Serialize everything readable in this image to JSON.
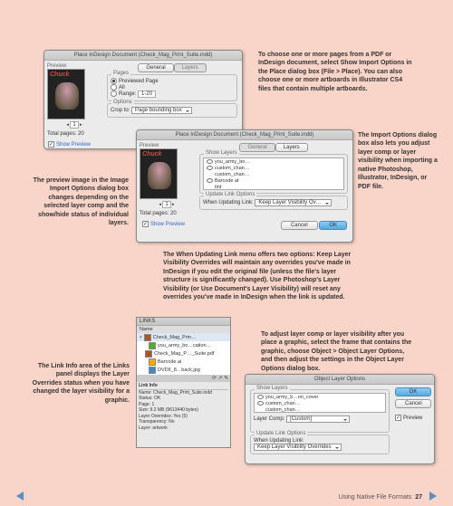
{
  "dialog1": {
    "title": "Place InDesign Document (Check_Mag_Print_Suite.indd)",
    "preview_label": "Preview",
    "total_pages": "Total pages: 20",
    "show_preview": "Show Preview",
    "tab_general": "General",
    "tab_layers": "Layers",
    "pages_label": "Pages",
    "opt_previewed": "Previewed Page",
    "opt_all": "All",
    "opt_range": "Range:",
    "range_value": "1-20",
    "options_label": "Options",
    "crop_to": "Crop to:",
    "crop_value": "Page bounding box"
  },
  "dialog2": {
    "title": "Place InDesign Document (Check_Mag_Print_Suite.indd)",
    "preview_label": "Preview",
    "total_pages": "Total pages: 20",
    "show_preview": "Show Preview",
    "tab_general": "General",
    "tab_layers": "Layers",
    "show_layers": "Show Layers",
    "layers": [
      "you_army_bo…",
      "custom_chan…",
      "custom_chan…",
      "Barcode at",
      "tint"
    ],
    "update_options": "Update Link Options",
    "when_updating": "When Updating Link:",
    "update_value": "Keep Layer Visibility Ov…",
    "cancel": "Cancel",
    "ok": "OK"
  },
  "links_panel": {
    "title": "LINKS",
    "name_col": "Name",
    "items": [
      "Check_Mag_Prin…",
      "you_army_bo…cation…",
      "Check_Mag_P…_Suite.pdf",
      "Barcode.ai",
      "DVDII_8…back.jpg"
    ],
    "info_name_label": "Name:",
    "info_name": "Check_Mag_Print_Suite.indd",
    "info_status_label": "Status:",
    "info_status": "OK",
    "info_page_label": "Page:",
    "info_page": "1",
    "info_size_label": "Size:",
    "info_size": "9.2 MB (9613440 bytes)",
    "info_overrides_label": "Layer Overrides:",
    "info_overrides": "Yes (5)",
    "info_transparency_label": "Transparency:",
    "info_transparency": "No",
    "info_layer_label": "Layer:",
    "info_layer": "artwork"
  },
  "dialog3": {
    "title": "Object Layer Options",
    "show_layers": "Show Layers",
    "layers": [
      "you_army_b…on_cover",
      "custom_chan…",
      "custom_chan…"
    ],
    "layer_comp_label": "Layer Comp:",
    "layer_comp_value": "[Custom]",
    "update_options": "Update Link Options",
    "when_updating": "When Updating Link:",
    "update_value": "Keep Layer Visibility Overrides",
    "ok": "OK",
    "cancel": "Cancel",
    "preview": "Preview"
  },
  "captions": {
    "c1": "To choose one or more pages from a PDF or InDesign document, select Show Import Options in the Place dialog box (File > Place). You can also choose one or more artboards in Illustrator CS4 files that contain multiple artboards.",
    "c2": "The Import Options dialog box also lets you adjust layer comp or layer visibility when importing a native Photoshop, Illustrator, InDesign, or PDF file.",
    "c3": "The preview image in the Image Import Options dialog box changes depending on the selected layer comp and the show/hide status of individual layers.",
    "c4": "The When Updating Link menu offers two options: Keep Layer Visibility Overrides will maintain any overrides you've made in InDesign if you edit the original file (unless the file's layer structure is significantly changed). Use Photoshop's Layer Visibility (or Use Document's Layer Visibility) will reset any overrides you've made in InDesign when the link is updated.",
    "c5": "The Link Info area of the Links panel displays the Layer Overrides status when you have changed the layer visibility for a graphic.",
    "c6": "To adjust layer comp or layer visibility after you place a graphic, select the frame that contains the graphic, choose Object > Object Layer Options, and then adjust the settings in the Object Layer Options dialog box."
  },
  "footer": {
    "text": "Using Native File Formats",
    "page": "27"
  }
}
